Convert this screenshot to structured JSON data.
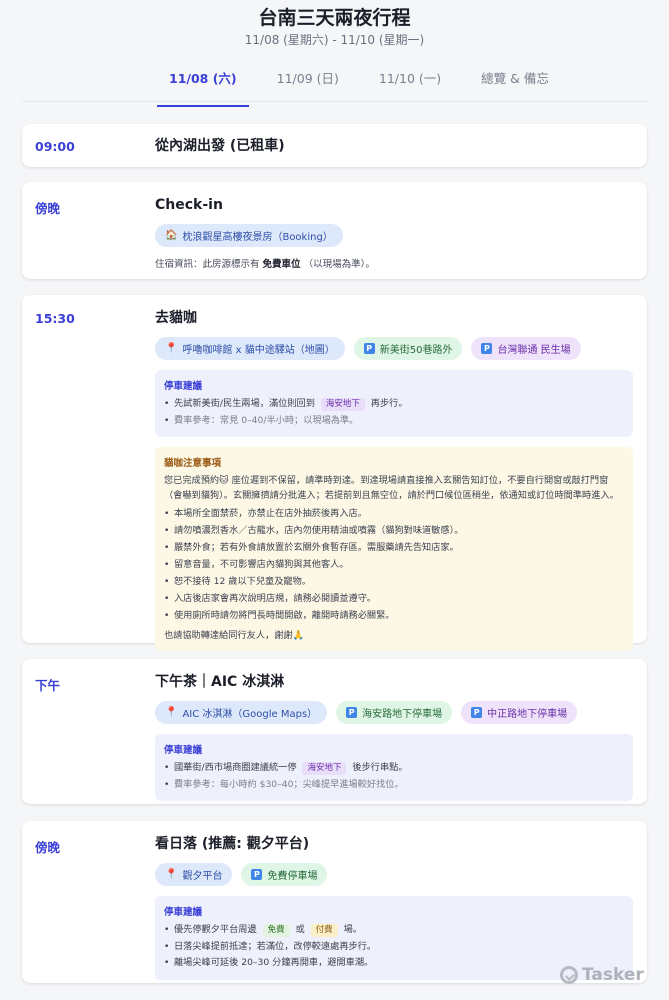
{
  "page": {
    "title": "台南三天兩夜行程",
    "subtitle": "11/08 (星期六) - 11/10 (星期一)"
  },
  "tabs": [
    {
      "label": "11/08 (六)",
      "active": true
    },
    {
      "label": "11/09 (日)",
      "active": false
    },
    {
      "label": "11/10 (一)",
      "active": false
    },
    {
      "label": "總覽 & 備忘",
      "active": false
    }
  ],
  "events": {
    "e1": {
      "time": "09:00",
      "title": "從內湖出發 (已租車)"
    },
    "e2": {
      "time": "傍晚",
      "title": "Check-in",
      "pill": {
        "icon": "house-icon",
        "label": "枕浪觀星高樓夜景房（Booking）"
      },
      "note_prefix": "住宿資訊：此房源標示有",
      "note_bold": "免費車位",
      "note_suffix": "（以現場為準）。"
    },
    "e3": {
      "time": "15:30",
      "title": "去貓咖",
      "pills": [
        {
          "icon": "pin-icon",
          "label": "呼嚕咖啡館 x 貓中途驛站（地圖）"
        },
        {
          "icon": "parking-icon",
          "label": "新美街50巷路外"
        },
        {
          "icon": "parking-icon",
          "label": "台灣聯通 民生場"
        }
      ],
      "parking": {
        "title": "停車建議",
        "line1_prefix": "先試新美街/民生兩場，滿位則回到",
        "line1_tag": "海安地下",
        "line1_suffix": "再步行。",
        "line2": "費率參考：常見 0–40/半小時；以現場為準。"
      },
      "cat": {
        "title": "貓咖注意事項",
        "para": "您已完成預約🐱 座位遲到不保留，請準時到達。到達現場請直接推入玄關告知訂位，不要自行開窗或敲打門窗（會嚇到貓狗）。玄關擁擠請分批進入；若提前到且無空位，請於門口候位區稍坐，依通知或訂位時間準時進入。",
        "items": [
          "本場所全面禁菸，亦禁止在店外抽菸後再入店。",
          "請勿噴濃烈香水／古龍水，店內勿使用精油或噴霧（貓狗對味道敏感）。",
          "嚴禁外食；若有外食請放置於玄關外食暫存區。需服藥請先告知店家。",
          "留意音量，不可影響店內貓狗與其他客人。",
          "恕不接待 12 歲以下兒童及寵物。",
          "入店後店家會再次說明店規，請務必閱讀並遵守。",
          "使用廁所時請勿將門長時間開啟，離開時請務必關緊。"
        ],
        "thanks": "也請協助轉達給同行友人，謝謝🙏"
      }
    },
    "e4": {
      "time": "下午",
      "title": "下午茶｜AIC 冰淇淋",
      "pills": [
        {
          "icon": "pin-icon",
          "label": "AIC 冰淇淋（Google Maps）"
        },
        {
          "icon": "parking-icon",
          "label": "海安路地下停車場"
        },
        {
          "icon": "parking-icon",
          "label": "中正路地下停車場"
        }
      ],
      "parking": {
        "title": "停車建議",
        "line1_prefix": "國華街/西市場商圈建議統一停",
        "line1_tag": "海安地下",
        "line1_suffix": "後步行串點。",
        "line2": "費率參考：每小時約 $30–40；尖峰提早進場較好找位。"
      }
    },
    "e5": {
      "time": "傍晚",
      "title": "看日落 (推薦: 觀夕平台)",
      "pills": [
        {
          "icon": "pin-icon",
          "label": "觀夕平台"
        },
        {
          "icon": "parking-icon",
          "label": "免費停車場"
        }
      ],
      "parking": {
        "title": "停車建議",
        "line1_prefix": "優先停觀夕平台周邊",
        "line1_tag_free": "免費",
        "line1_mid": "或",
        "line1_tag_paid": "付費",
        "line1_suffix": "場。",
        "line2": "日落尖峰提前抵達；若滿位，改停較遠處再步行。",
        "line3": "離場尖峰可延後 20–30 分鐘再開車，避開車潮。"
      }
    }
  },
  "branding": {
    "logo_text": "Tasker"
  },
  "colors": {
    "accent": "#3a3fd6",
    "pin": "#e0394a",
    "parking": "#3f86e8"
  }
}
